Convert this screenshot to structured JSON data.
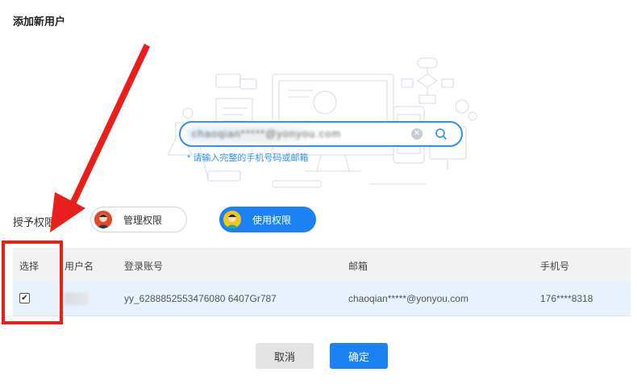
{
  "dialog": {
    "title": "添加新用户"
  },
  "search": {
    "value": "chaoqian*****@yonyou.com",
    "hint": "* 请输入完整的手机号码或邮箱"
  },
  "permission": {
    "label": "授予权限",
    "options": [
      {
        "label": "管理权限",
        "selected": false
      },
      {
        "label": "使用权限",
        "selected": true
      }
    ]
  },
  "table": {
    "headers": [
      "选择",
      "用户名",
      "登录账号",
      "邮箱",
      "手机号"
    ],
    "rows": [
      {
        "selected": true,
        "username": "",
        "login": "yy_6288852553476080 6407Gr787",
        "email": "chaoqian*****@yonyou.com",
        "phone": "176****8318"
      }
    ]
  },
  "buttons": {
    "cancel": "取消",
    "confirm": "确定"
  },
  "colors": {
    "accent": "#1a82f2",
    "annotation": "#e8201c",
    "row_selected": "#e8f2fc"
  }
}
